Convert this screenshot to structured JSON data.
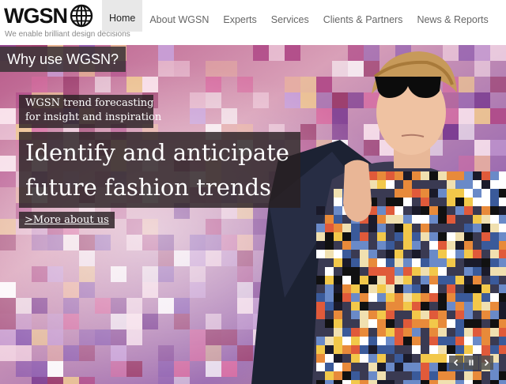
{
  "brand": {
    "logo_text": "WGSN",
    "tagline": "We enable brilliant design decisions"
  },
  "nav": {
    "items": [
      {
        "label": "Home",
        "active": true
      },
      {
        "label": "About WGSN",
        "active": false
      },
      {
        "label": "Experts",
        "active": false
      },
      {
        "label": "Services",
        "active": false
      },
      {
        "label": "Clients & Partners",
        "active": false
      },
      {
        "label": "News & Reports",
        "active": false
      }
    ]
  },
  "hero": {
    "tab_label": "Why use WGSN?",
    "kicker_lines": [
      "WGSN trend forecasting",
      "for insight and inspiration"
    ],
    "headline_lines": [
      "Identify and anticipate",
      "future fashion trends"
    ],
    "cta_label": ">More about us",
    "controls": {
      "prev_icon": "chevron-left-icon",
      "pause_icon": "pause-icon",
      "next_icon": "chevron-right-icon"
    }
  },
  "colors": {
    "overlay": "#2a2022",
    "nav_active_bg": "#e8e8e8",
    "tagline": "#8a8a8a",
    "mosaic_pink": "#c84a8a",
    "mosaic_purple": "#7a5aa8",
    "mosaic_orange": "#e88a3a",
    "mosaic_yellow": "#f2c84a"
  }
}
